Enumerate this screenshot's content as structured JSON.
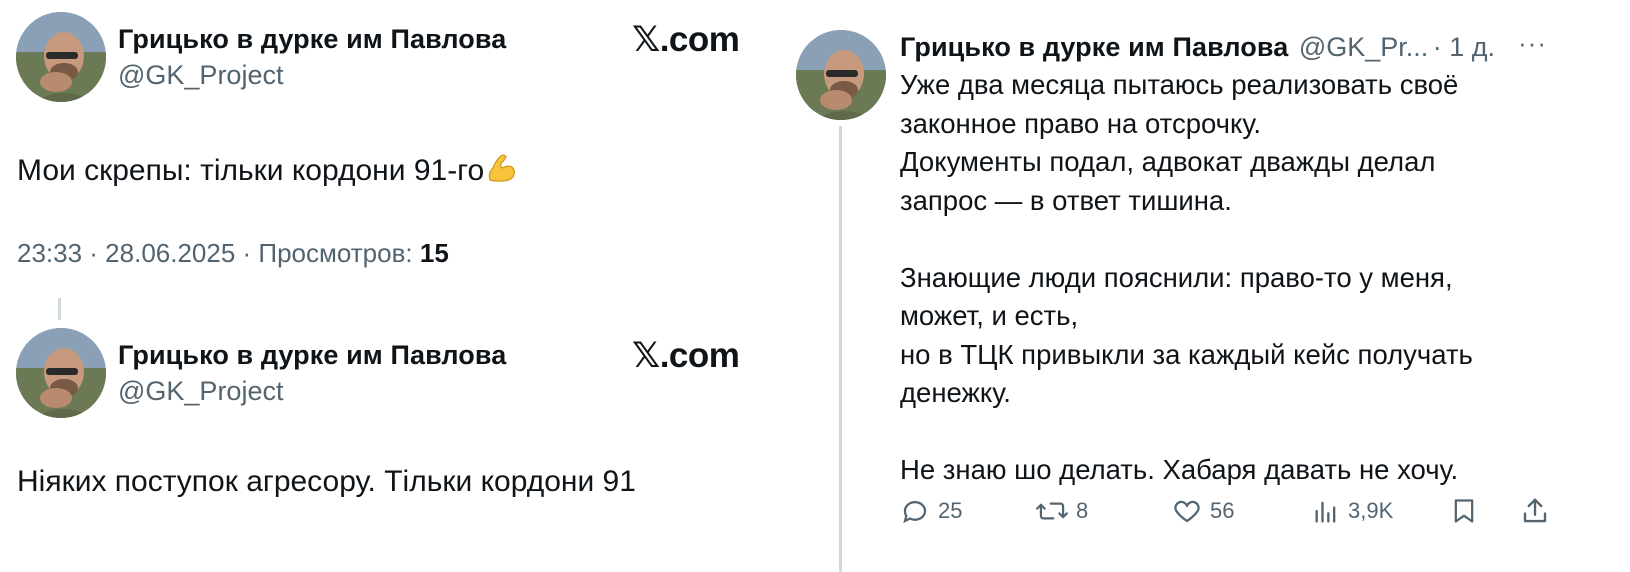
{
  "left": {
    "tweet1": {
      "author_name": "Грицько в дурке им Павлова",
      "author_handle": "@GK_Project",
      "source": ".com",
      "text": "Мои скрепы: тільки кордони 91-го",
      "emoji": "flexed-biceps",
      "time": "23:33 · 28.06.2025 · Просмотров: ",
      "views": "15"
    },
    "tweet2": {
      "author_name": "Грицько в дурке им Павлова",
      "author_handle": "@GK_Project",
      "source": ".com",
      "text": "Ніяких поступок агресору. Тільки кордони 91"
    }
  },
  "right": {
    "author_name": "Грицько в дурке им Павлова",
    "author_handle": "@GK_Pr...",
    "time": "· 1 д.",
    "more": "···",
    "lines": [
      "Уже два месяца пытаюсь реализовать своё",
      "законное право на отсрочку.",
      "Документы подал, адвокат дважды делал",
      "запрос — в ответ тишина.",
      "",
      "Знающие люди пояснили: право-то у меня,",
      "может, и есть,",
      "но в ТЦК привыкли за каждый кейс получать",
      "денежку.",
      "",
      "Не знаю шо делать. Хабаря давать не хочу."
    ],
    "actions": {
      "replies": "25",
      "reposts": "8",
      "likes": "56",
      "views": "3,9K"
    }
  },
  "colors": {
    "text": "#0f1419",
    "secondary": "#536471",
    "divider": "#cfd9de"
  }
}
